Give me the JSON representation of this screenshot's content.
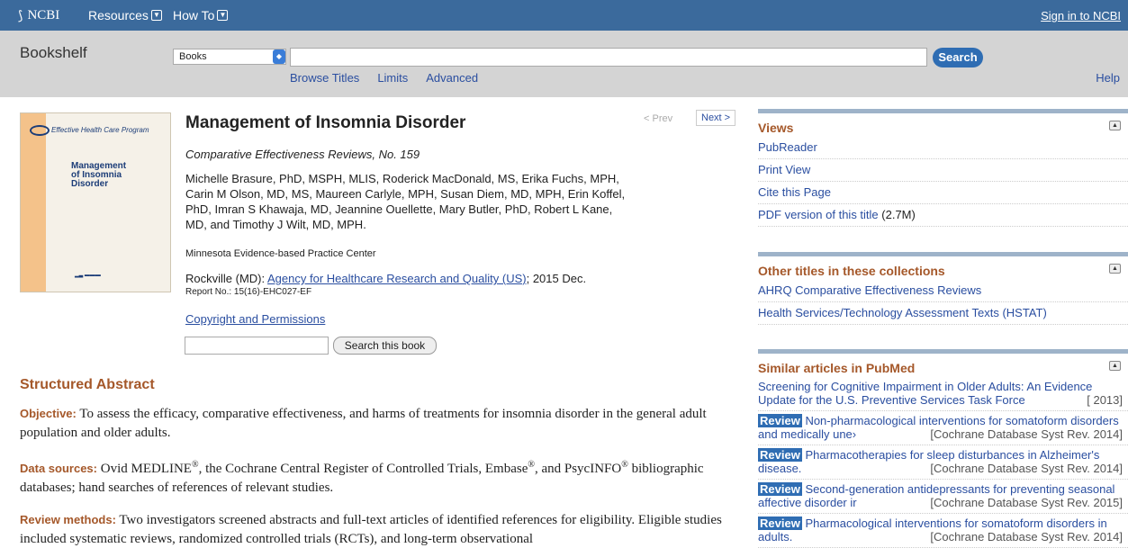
{
  "topbar": {
    "logo_text": "NCBI",
    "resources": "Resources",
    "howto": "How To",
    "signin": "Sign in to NCBI"
  },
  "search": {
    "db_label": "Bookshelf",
    "db_select": "Books",
    "button": "Search",
    "links": [
      "Browse Titles",
      "Limits",
      "Advanced"
    ],
    "help": "Help"
  },
  "cover": {
    "program": "Effective Health Care Program",
    "title_lines": [
      "Management",
      "of Insomnia",
      "Disorder"
    ]
  },
  "book": {
    "title": "Management of Insomnia Disorder",
    "prev": "< Prev",
    "next": "Next >",
    "series": "Comparative Effectiveness Reviews, No. 159",
    "authors": "Michelle Brasure, PhD, MSPH, MLIS, Roderick MacDonald, MS, Erika Fuchs, MPH, Carin M Olson, MD, MS, Maureen Carlyle, MPH, Susan Diem, MD, MPH, Erin Koffel, PhD, Imran S Khawaja, MD, Jeannine Ouellette, Mary Butler, PhD, Robert L Kane, MD, and Timothy J Wilt, MD, MPH.",
    "center": "Minnesota Evidence-based Practice Center",
    "pub_prefix": "Rockville (MD): ",
    "publisher": "Agency for Healthcare Research and Quality (US)",
    "pub_suffix": "; 2015 Dec.",
    "report": "Report No.: 15(16)-EHC027-EF",
    "copyright": "Copyright and Permissions",
    "search_button": "Search this book"
  },
  "abstract": {
    "heading": "Structured Abstract",
    "objective_label": "Objective:",
    "objective_text": " To assess the efficacy, comparative effectiveness, and harms of treatments for insomnia disorder in the general adult population and older adults.",
    "sources_label": "Data sources:",
    "sources_a": " Ovid MEDLINE",
    "sources_b": ", the Cochrane Central Register of Controlled Trials, Embase",
    "sources_c": ", and PsycINFO",
    "sources_d": " bibliographic databases; hand searches of references of relevant studies.",
    "reg": "®",
    "methods_label": "Review methods:",
    "methods_text": " Two investigators screened abstracts and full-text articles of identified references for eligibility. Eligible studies included systematic reviews, randomized controlled trials (RCTs), and long-term observational"
  },
  "views": {
    "heading": "Views",
    "items": [
      "PubReader",
      "Print View",
      "Cite this Page",
      "PDF version of this title"
    ],
    "pdf_size": " (2.7M)"
  },
  "collections": {
    "heading": "Other titles in these collections",
    "items": [
      "AHRQ Comparative Effectiveness Reviews",
      "Health Services/Technology Assessment Texts (HSTAT)"
    ]
  },
  "similar": {
    "heading": "Similar articles in PubMed",
    "review_badge": "Review",
    "items": [
      {
        "text": "Screening for Cognitive Impairment in Older Adults: An Evidence Update for the U.S. Preventive Services Task Force",
        "source": "[ 2013]",
        "review": false
      },
      {
        "text": "Non-pharmacological interventions for somatoform disorders and medically une›",
        "source": "[Cochrane Database Syst Rev. 2014]",
        "review": true
      },
      {
        "text": "Pharmacotherapies for sleep disturbances in Alzheimer's disease.",
        "source": "[Cochrane Database Syst Rev. 2014]",
        "review": true
      },
      {
        "text": "Second-generation antidepressants for preventing seasonal affective disorder ir",
        "source": "[Cochrane Database Syst Rev. 2015]",
        "review": true
      },
      {
        "text": "Pharmacological interventions for somatoform disorders in adults.",
        "source": "[Cochrane Database Syst Rev. 2014]",
        "review": true
      }
    ]
  }
}
